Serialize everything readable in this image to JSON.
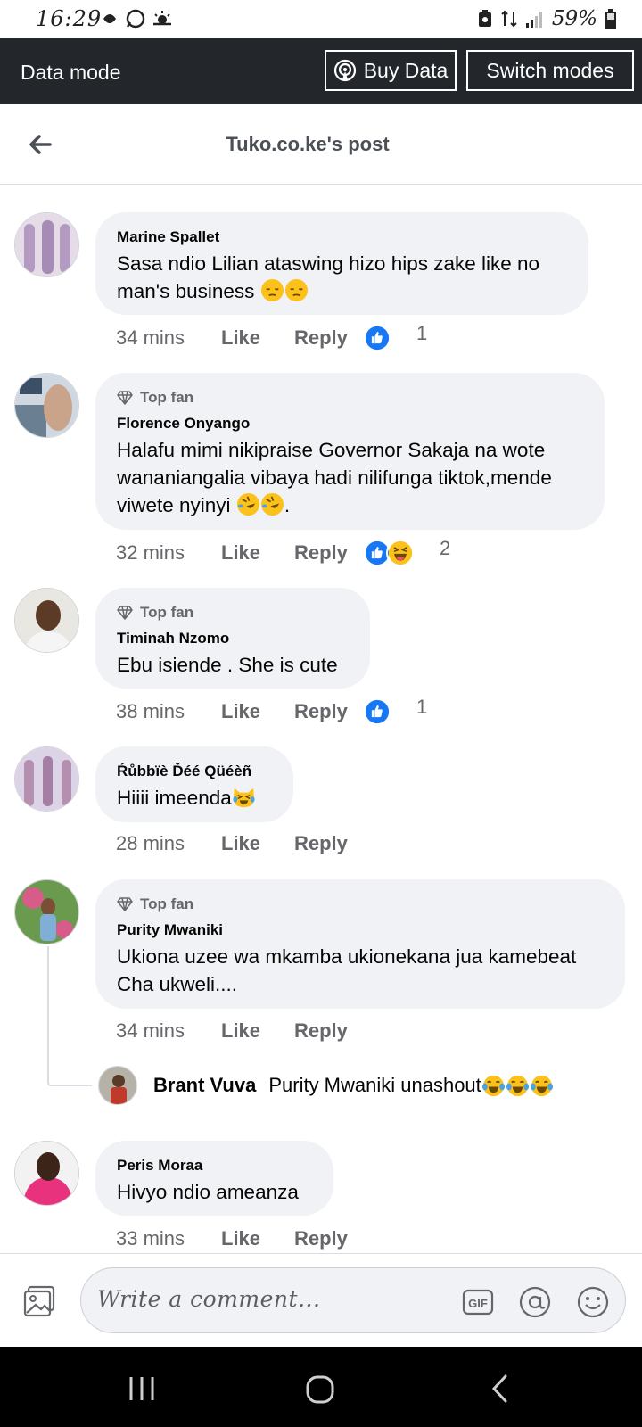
{
  "status_bar": {
    "time": "16:29",
    "battery": "59%"
  },
  "data_banner": {
    "mode_label": "Data mode",
    "buy_data_label": "Buy Data",
    "switch_modes_label": "Switch modes"
  },
  "header": {
    "title": "Tuko.co.ke's post"
  },
  "comments": [
    {
      "author": "Marine Spallet",
      "top_fan": false,
      "text": "Sasa ndio Lilian ataswing hizo hips zake like no man's business",
      "emojis": [
        "pensive-face-icon",
        "pensive-face-icon"
      ],
      "time": "34 mins",
      "like_label": "Like",
      "reply_label": "Reply",
      "reactions": [
        "like-reaction-icon"
      ],
      "reaction_count": "1"
    },
    {
      "author": "Florence Onyango",
      "top_fan": true,
      "top_fan_label": "Top fan",
      "text_line1": "Halafu mimi nikipraise Governor Sakaja na wote",
      "text_line2": "wananiangalia vibaya hadi nilifunga tiktok,mende",
      "text_line3": "viwete nyinyi",
      "text_line3_suffix": ".",
      "emojis": [
        "rolling-laughing-face-icon",
        "rolling-laughing-face-icon"
      ],
      "time": "32 mins",
      "like_label": "Like",
      "reply_label": "Reply",
      "reactions": [
        "like-reaction-icon",
        "haha-reaction-icon"
      ],
      "reaction_count": "2"
    },
    {
      "author": "Timinah Nzomo",
      "top_fan": true,
      "top_fan_label": "Top fan",
      "text": "Ebu isiende . She is cute",
      "time": "38 mins",
      "like_label": "Like",
      "reply_label": "Reply",
      "reactions": [
        "like-reaction-icon"
      ],
      "reaction_count": "1"
    },
    {
      "author": "Ŕůbbïè Ďéé Qüéèñ",
      "top_fan": false,
      "text": "Hiiii imeenda",
      "emojis": [
        "crying-laughing-cat-icon"
      ],
      "time": "28 mins",
      "like_label": "Like",
      "reply_label": "Reply"
    },
    {
      "author": "Purity Mwaniki",
      "top_fan": true,
      "top_fan_label": "Top fan",
      "text_line1": "Ukiona uzee wa mkamba ukionekana jua kamebeat",
      "text_line2": "Cha ukweli....",
      "time": "34 mins",
      "like_label": "Like",
      "reply_label": "Reply",
      "reply": {
        "author": "Brant Vuva",
        "text": "Purity Mwaniki unashout",
        "emojis": [
          "tears-of-joy-face-icon",
          "tears-of-joy-face-icon",
          "tears-of-joy-face-icon"
        ]
      }
    },
    {
      "author": "Peris Moraa",
      "top_fan": false,
      "text": "Hivyo ndio ameanza",
      "time": "33 mins",
      "like_label": "Like",
      "reply_label": "Reply"
    }
  ],
  "composer": {
    "placeholder": "Write a comment...",
    "gif_label": "GIF"
  },
  "colors": {
    "banner_bg": "#23272c",
    "bubble_bg": "#f0f2f5",
    "like_blue": "#1877f2",
    "muted_text": "#65676b",
    "emoji_yellow": "#fcc21b"
  }
}
